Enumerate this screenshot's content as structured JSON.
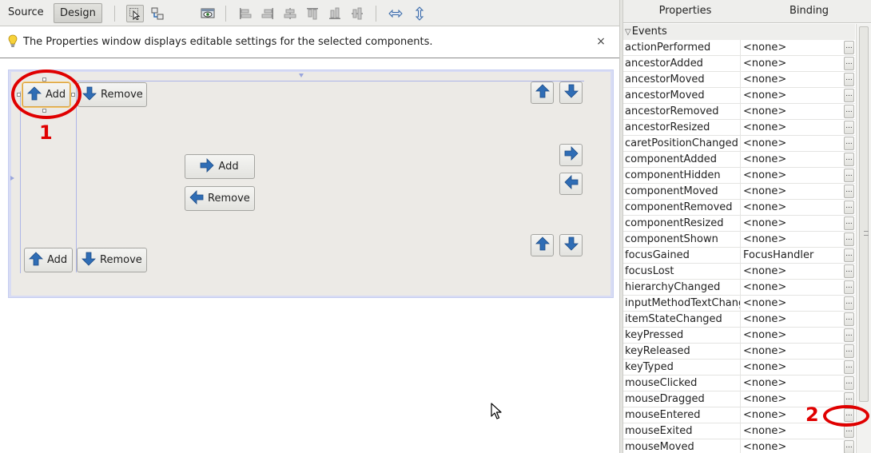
{
  "toolbar": {
    "source_label": "Source",
    "design_label": "Design",
    "icons": [
      "selection-mode-icon",
      "connection-mode-icon",
      "preview-design-icon",
      "align-left-icon",
      "align-right-icon",
      "center-horizontal-icon",
      "align-top-icon",
      "align-bottom-icon",
      "center-vertical-icon",
      "change-horizontal-resizability-icon",
      "change-vertical-resizability-icon"
    ]
  },
  "infobar": {
    "message": "The Properties window displays editable settings for the selected components.",
    "close_glyph": "×"
  },
  "form": {
    "buttons": {
      "top_add": "Add",
      "top_remove": "Remove",
      "mid_add": "Add",
      "mid_remove": "Remove",
      "bottom_add": "Add",
      "bottom_remove": "Remove"
    }
  },
  "callouts": {
    "first": "1",
    "second": "2"
  },
  "properties_panel": {
    "tabs": [
      "Properties",
      "Binding"
    ],
    "section": "Events",
    "rows": [
      {
        "name": "actionPerformed",
        "value": "<none>"
      },
      {
        "name": "ancestorAdded",
        "value": "<none>"
      },
      {
        "name": "ancestorMoved",
        "value": "<none>"
      },
      {
        "name": "ancestorMoved",
        "value": "<none>"
      },
      {
        "name": "ancestorRemoved",
        "value": "<none>"
      },
      {
        "name": "ancestorResized",
        "value": "<none>"
      },
      {
        "name": "caretPositionChanged",
        "value": "<none>"
      },
      {
        "name": "componentAdded",
        "value": "<none>"
      },
      {
        "name": "componentHidden",
        "value": "<none>"
      },
      {
        "name": "componentMoved",
        "value": "<none>"
      },
      {
        "name": "componentRemoved",
        "value": "<none>"
      },
      {
        "name": "componentResized",
        "value": "<none>"
      },
      {
        "name": "componentShown",
        "value": "<none>"
      },
      {
        "name": "focusGained",
        "value": "FocusHandler"
      },
      {
        "name": "focusLost",
        "value": "<none>"
      },
      {
        "name": "hierarchyChanged",
        "value": "<none>"
      },
      {
        "name": "inputMethodTextChanged",
        "value": "<none>"
      },
      {
        "name": "itemStateChanged",
        "value": "<none>"
      },
      {
        "name": "keyPressed",
        "value": "<none>"
      },
      {
        "name": "keyReleased",
        "value": "<none>"
      },
      {
        "name": "keyTyped",
        "value": "<none>"
      },
      {
        "name": "mouseClicked",
        "value": "<none>"
      },
      {
        "name": "mouseDragged",
        "value": "<none>"
      },
      {
        "name": "mouseEntered",
        "value": "<none>"
      },
      {
        "name": "mouseExited",
        "value": "<none>"
      },
      {
        "name": "mouseMoved",
        "value": "<none>"
      }
    ],
    "ellipsis": "..."
  },
  "colors": {
    "callout": "#e00000",
    "selection": "#d9a23f",
    "arrow_blue": "#2f6db5"
  }
}
